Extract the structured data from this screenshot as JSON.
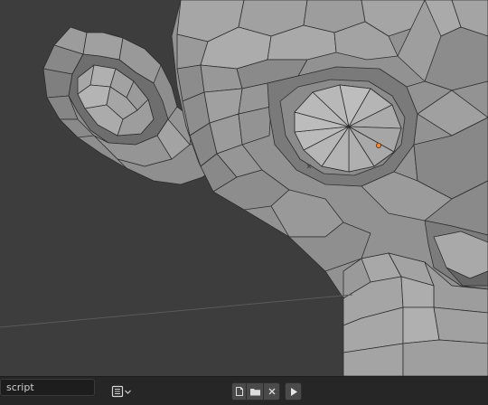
{
  "viewport": {
    "background_color": "#3d3d3d",
    "mesh_color": "#9a9a9a",
    "wire_color": "#2e2e2e",
    "origin_marker_color": "#f0883a"
  },
  "text_editor_header": {
    "editor_type_icon": "text-editor-icon",
    "dropdown_icon": "chevron-down-icon",
    "text_block_name": "script",
    "new_icon": "new-document-icon",
    "open_icon": "folder-icon",
    "unlink_icon": "close-icon",
    "run_icon": "play-icon"
  }
}
